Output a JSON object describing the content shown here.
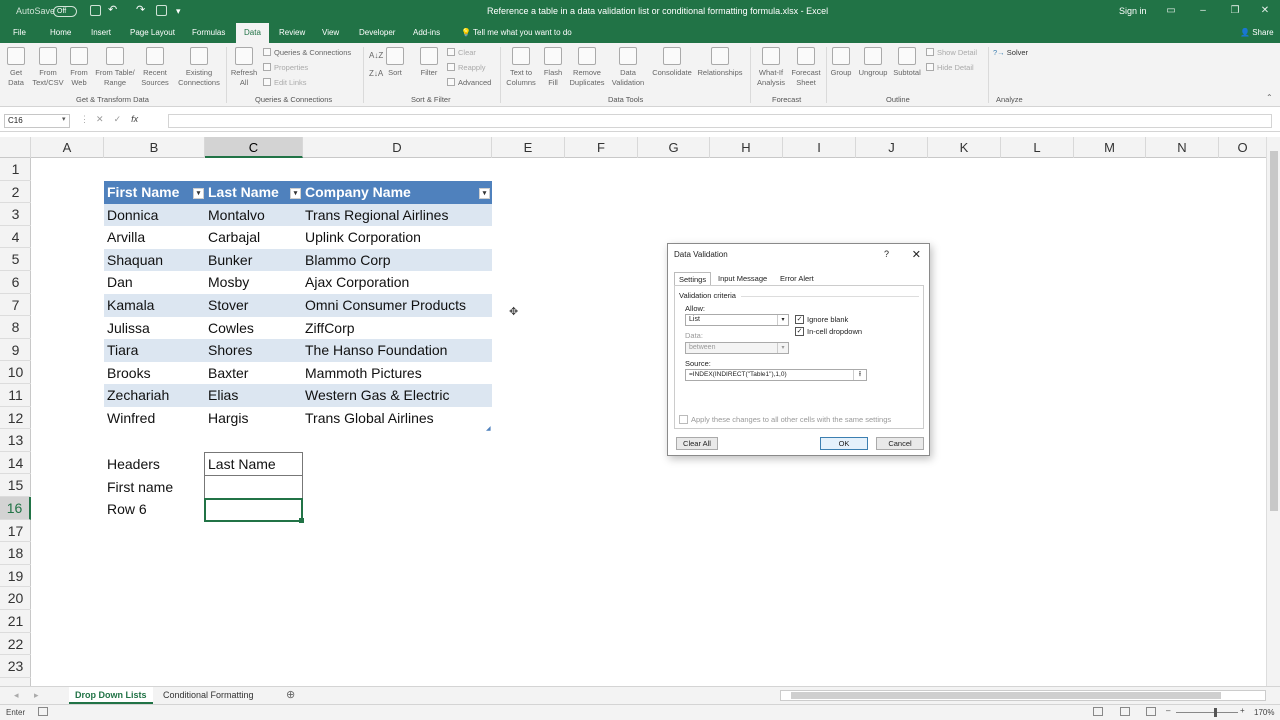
{
  "window": {
    "autosave_label": "AutoSave",
    "autosave_state": "Off",
    "title": "Reference a table in a data validation list or conditional formatting formula.xlsx  -  Excel",
    "signin": "Sign in"
  },
  "tabs": [
    "File",
    "Home",
    "Insert",
    "Page Layout",
    "Formulas",
    "Data",
    "Review",
    "View",
    "Developer",
    "Add-ins"
  ],
  "active_tab": "Data",
  "tell_me": "Tell me what you want to do",
  "share": "Share",
  "ribbon": {
    "get_data": "Get Data",
    "from_text": "From Text/CSV",
    "from_web": "From Web",
    "from_table": "From Table/ Range",
    "recent_sources": "Recent Sources",
    "existing": "Existing Connections",
    "group_get": "Get & Transform Data",
    "refresh": "Refresh All",
    "queries": "Queries & Connections",
    "properties": "Properties",
    "edit_links": "Edit Links",
    "group_queries": "Queries & Connections",
    "sort": "Sort",
    "filter": "Filter",
    "clear": "Clear",
    "reapply": "Reapply",
    "advanced": "Advanced",
    "group_sort": "Sort & Filter",
    "text_to_columns": "Text to Columns",
    "flash_fill": "Flash Fill",
    "remove_duplicates": "Remove Duplicates",
    "data_validation": "Data Validation",
    "consolidate": "Consolidate",
    "relationships": "Relationships",
    "group_tools": "Data Tools",
    "what_if": "What-If Analysis",
    "forecast_sheet": "Forecast Sheet",
    "group_forecast": "Forecast",
    "group_btn": "Group",
    "ungroup": "Ungroup",
    "subtotal": "Subtotal",
    "show_detail": "Show Detail",
    "hide_detail": "Hide Detail",
    "group_outline": "Outline",
    "solver": "Solver",
    "group_analyze": "Analyze"
  },
  "name_box": "C16",
  "columns": [
    "A",
    "B",
    "C",
    "D",
    "E",
    "F",
    "G",
    "H",
    "I",
    "J",
    "K",
    "L",
    "M",
    "N",
    "O"
  ],
  "rows": [
    "1",
    "2",
    "3",
    "4",
    "5",
    "6",
    "7",
    "8",
    "9",
    "10",
    "11",
    "12",
    "13",
    "14",
    "15",
    "16",
    "17",
    "18",
    "19",
    "20",
    "21",
    "22",
    "23"
  ],
  "table": {
    "headers": [
      "First Name",
      "Last Name",
      "Company Name"
    ],
    "rows": [
      [
        "Donnica",
        "Montalvo",
        "Trans Regional Airlines"
      ],
      [
        "Arvilla",
        "Carbajal",
        "Uplink Corporation"
      ],
      [
        "Shaquan",
        "Bunker",
        "Blammo Corp"
      ],
      [
        "Dan",
        "Mosby",
        "Ajax Corporation"
      ],
      [
        "Kamala",
        "Stover",
        "Omni Consumer Products"
      ],
      [
        "Julissa",
        "Cowles",
        "ZiffCorp"
      ],
      [
        "Tiara",
        "Shores",
        "The Hanso Foundation"
      ],
      [
        "Brooks",
        "Baxter",
        "Mammoth Pictures"
      ],
      [
        "Zechariah",
        "Elias",
        "Western Gas & Electric"
      ],
      [
        "Winfred",
        "Hargis",
        "Trans Global Airlines"
      ]
    ],
    "band_color": "#dce6f1",
    "header_color": "#4f81bd"
  },
  "lookup": {
    "label_headers": "Headers",
    "value_headers": "Last Name",
    "label_first": "First name",
    "label_row": "Row 6"
  },
  "dialog": {
    "title": "Data Validation",
    "help": "?",
    "tabs": [
      "Settings",
      "Input Message",
      "Error Alert"
    ],
    "criteria": "Validation criteria",
    "allow_label": "Allow:",
    "allow_value": "List",
    "ignore_blank": "Ignore blank",
    "incell_dropdown": "In-cell dropdown",
    "data_label": "Data:",
    "data_value": "between",
    "source_label": "Source:",
    "source_value": "=INDEX(INDIRECT(\"Table1\"),1,0)",
    "apply_all": "Apply these changes to all other cells with the same settings",
    "clear_all": "Clear All",
    "ok": "OK",
    "cancel": "Cancel"
  },
  "sheets": [
    "Drop Down Lists",
    "Conditional Formatting"
  ],
  "active_sheet": "Drop Down Lists",
  "status": "Enter",
  "zoom": "170%",
  "colors": {
    "excel_green": "#217346"
  }
}
